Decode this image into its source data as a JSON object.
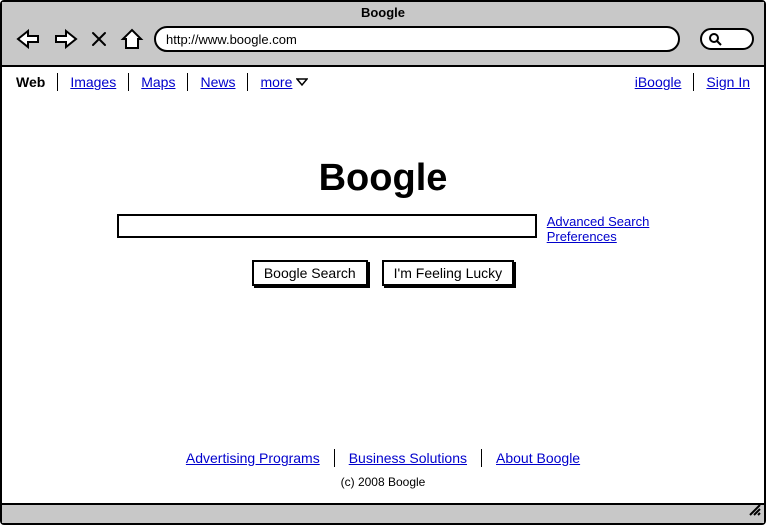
{
  "window": {
    "title": "Boogle",
    "url": "http://www.boogle.com"
  },
  "nav": {
    "active": "Web",
    "items": [
      "Images",
      "Maps",
      "News"
    ],
    "more": "more",
    "right": [
      "iBoogle",
      "Sign In"
    ]
  },
  "brand": "Boogle",
  "side": {
    "advanced": "Advanced Search",
    "prefs": "Preferences"
  },
  "buttons": {
    "search": "Boogle Search",
    "lucky": "I'm Feeling Lucky"
  },
  "footer": {
    "links": [
      "Advertising Programs",
      "Business Solutions",
      "About Boogle"
    ],
    "copyright": "(c) 2008 Boogle"
  }
}
